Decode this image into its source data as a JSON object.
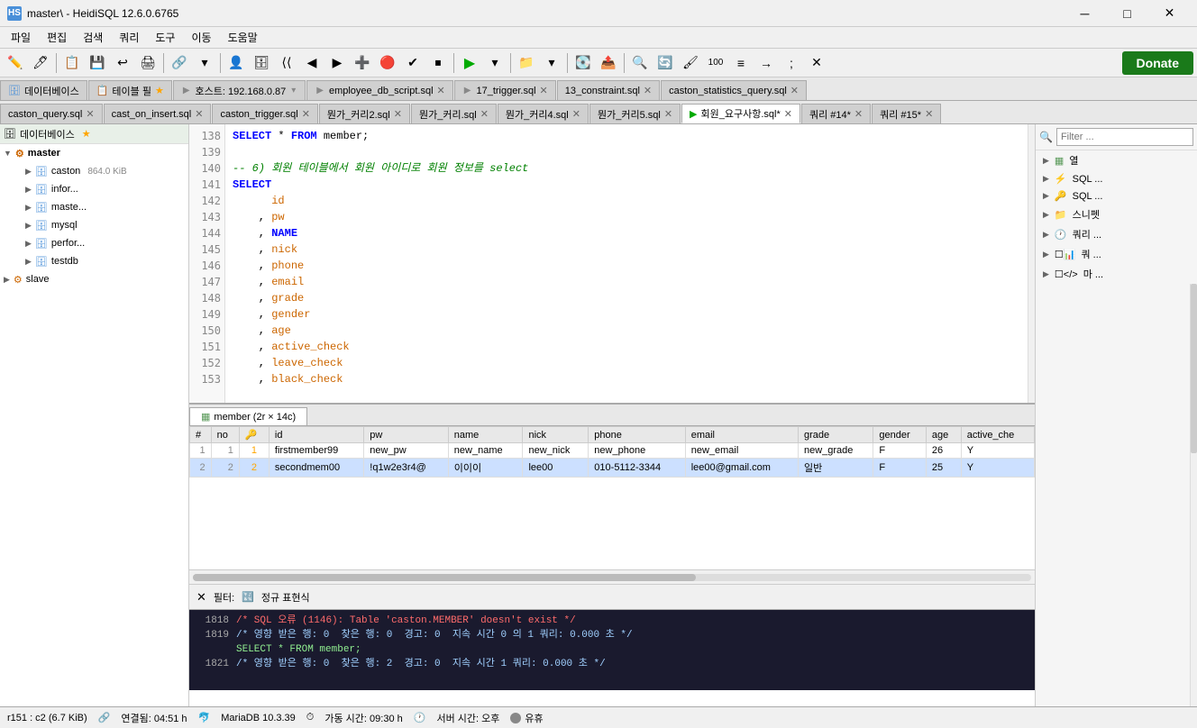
{
  "titlebar": {
    "title": "master\\ - HeidiSQL 12.6.0.6765",
    "icon": "HS",
    "min_label": "─",
    "max_label": "□",
    "close_label": "✕"
  },
  "menubar": {
    "items": [
      "파일",
      "편집",
      "검색",
      "쿼리",
      "도구",
      "이동",
      "도움말"
    ]
  },
  "toolbar": {
    "donate_label": "Donate"
  },
  "tabs_row1": [
    {
      "label": "데이터베이스",
      "active": false,
      "closable": false
    },
    {
      "label": "테이블 필",
      "active": false,
      "closable": false
    },
    {
      "label": "호스트: 192.168.0.87",
      "active": false,
      "closable": false
    },
    {
      "label": "employee_db_script.sql",
      "active": false,
      "closable": true
    },
    {
      "label": "17_trigger.sql",
      "active": false,
      "closable": true
    },
    {
      "label": "13_constraint.sql",
      "active": false,
      "closable": true
    },
    {
      "label": "caston_statistics_query.sql",
      "active": false,
      "closable": true
    }
  ],
  "tabs_row2": [
    {
      "label": "caston_query.sql",
      "active": false,
      "closable": true
    },
    {
      "label": "cast_on_insert.sql",
      "active": false,
      "closable": true
    },
    {
      "label": "caston_trigger.sql",
      "active": false,
      "closable": true
    },
    {
      "label": "뭔가_커리2.sql",
      "active": false,
      "closable": true
    },
    {
      "label": "뭔가_커리.sql",
      "active": false,
      "closable": true
    },
    {
      "label": "뭔가_커리4.sql",
      "active": false,
      "closable": true
    },
    {
      "label": "뭔가_커리5.sql",
      "active": false,
      "closable": true
    },
    {
      "label": "회원_요구사항.sql",
      "active": true,
      "closable": true,
      "modified": true
    },
    {
      "label": "쿼리 #14",
      "active": false,
      "closable": true,
      "modified": true
    },
    {
      "label": "쿼리 #15",
      "active": false,
      "closable": true,
      "modified": true
    }
  ],
  "sidebar": {
    "headers": [
      "데이터베이스",
      "테이블 필터"
    ],
    "master": {
      "label": "master",
      "children": [
        {
          "label": "caston",
          "size": "864.0 KiB"
        },
        {
          "label": "infor...",
          "size": ""
        },
        {
          "label": "maste...",
          "size": ""
        },
        {
          "label": "mysql",
          "size": ""
        },
        {
          "label": "perfor...",
          "size": ""
        },
        {
          "label": "testdb",
          "size": ""
        }
      ]
    },
    "slave": {
      "label": "slave"
    }
  },
  "editor": {
    "lines": [
      {
        "num": "138",
        "content": "SELECT * FROM member;"
      },
      {
        "num": "139",
        "content": ""
      },
      {
        "num": "140",
        "content": "-- 6) 회원 테이블에서 회원 아이디로 회원 정보를 select"
      },
      {
        "num": "141",
        "content": "SELECT"
      },
      {
        "num": "142",
        "content": "      id"
      },
      {
        "num": "143",
        "content": "    , pw"
      },
      {
        "num": "144",
        "content": "    , NAME"
      },
      {
        "num": "145",
        "content": "    , nick"
      },
      {
        "num": "146",
        "content": "    , phone"
      },
      {
        "num": "147",
        "content": "    , email"
      },
      {
        "num": "148",
        "content": "    , grade"
      },
      {
        "num": "149",
        "content": "    , gender"
      },
      {
        "num": "150",
        "content": "    , age"
      },
      {
        "num": "151",
        "content": "    , active_check"
      },
      {
        "num": "152",
        "content": "    , leave_check"
      },
      {
        "num": "153",
        "content": "    , black_check"
      }
    ]
  },
  "right_panel": {
    "filter_placeholder": "Filter ...",
    "items": [
      {
        "label": "열",
        "icon": "table"
      },
      {
        "label": "SQL ...",
        "icon": "sql1"
      },
      {
        "label": "SQL ...",
        "icon": "sql2"
      },
      {
        "label": "스니펫",
        "icon": "snippet"
      },
      {
        "label": "쿼리 ...",
        "icon": "query"
      },
      {
        "label": "쿼 ...",
        "icon": "chart"
      },
      {
        "label": "마 ...",
        "icon": "code"
      }
    ]
  },
  "result": {
    "tab_label": "member (2r × 14c)",
    "columns": [
      "#",
      "no",
      "🔑",
      "id",
      "pw",
      "name",
      "nick",
      "phone",
      "email",
      "grade",
      "gender",
      "age",
      "active_che"
    ],
    "rows": [
      {
        "rownum": "1",
        "no": "1",
        "key": "1",
        "id": "firstmember99",
        "pw": "new_pw",
        "name": "new_name",
        "nick": "new_nick",
        "phone": "new_phone",
        "email": "new_email",
        "grade": "new_grade",
        "gender": "F",
        "age": "26",
        "active_check": "Y",
        "selected": false
      },
      {
        "rownum": "2",
        "no": "2",
        "key": "2",
        "id": "secondmem00",
        "pw": "!q1w2e3r4@",
        "name": "이이이",
        "nick": "lee00",
        "phone": "010-5112-3344",
        "email": "lee00@gmail.com",
        "grade": "일반",
        "gender": "F",
        "age": "25",
        "active_check": "Y",
        "selected": true
      }
    ]
  },
  "filter_bar": {
    "clear_label": "✕",
    "label": "필터:",
    "regex_label": "정규 표현식"
  },
  "log": {
    "lines": [
      {
        "num": "1818",
        "text": "/* SQL 오류 (1146): Table 'caston.MEMBER' doesn't exist */",
        "type": "error"
      },
      {
        "num": "1819",
        "text": "/* 영향 받은 행: 0  찾은 행: 0  경고: 0  지속 시간 0 의 1 쿼리: 0.000 초 */",
        "type": "info"
      },
      {
        "num": "",
        "text": "SELECT * FROM member;",
        "type": "sql"
      },
      {
        "num": "1821",
        "text": "/* 영향 받은 행: 0  찾은 행: 2  경고: 0  지속 시간 1 쿼리: 0.000 초 */",
        "type": "info"
      }
    ]
  },
  "statusbar": {
    "position": "r151 : c2 (6.7 KiB)",
    "connection": "연결됨: 04:51 h",
    "db_type": "MariaDB 10.3.39",
    "uptime": "가동 시간: 09:30 h",
    "server_time": "서버 시간: 오후",
    "idle": "유휴"
  }
}
